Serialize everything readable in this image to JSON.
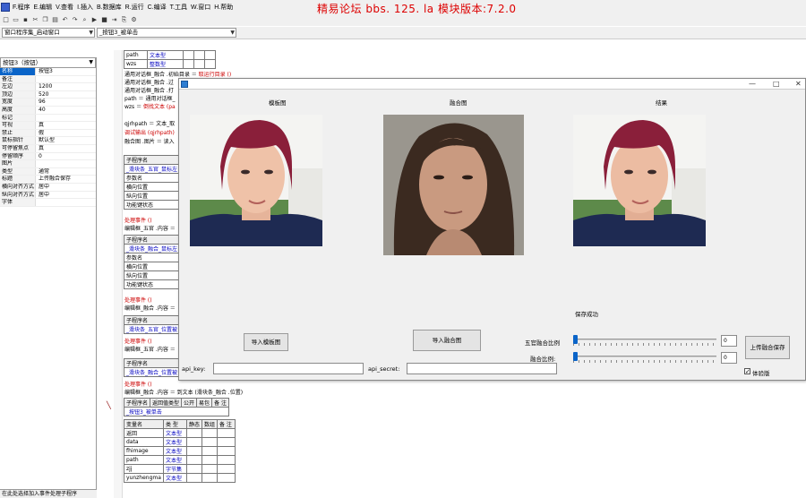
{
  "menu": {
    "items": [
      "F.程序",
      "E.编辑",
      "V.查看",
      "I.插入",
      "B.数据库",
      "R.运行",
      "C.编译",
      "T.工具",
      "W.窗口",
      "H.帮助"
    ],
    "brand": "精易论坛 bbs. 125. la 模块版本:7.2.0"
  },
  "toolbar": {
    "icons": [
      "new-icon",
      "open-icon",
      "save-icon",
      "cut-icon",
      "copy-icon",
      "paste-icon",
      "run-icon",
      "stop-icon"
    ]
  },
  "combos": {
    "window_select": "窗口程序集_启动窗口",
    "event_select": "_按钮3_被单击"
  },
  "left_panel": {
    "object_select": "按钮3（按钮）",
    "props": [
      {
        "name": "名称",
        "value": "按钮3",
        "selected": true
      },
      {
        "name": "备注",
        "value": ""
      },
      {
        "name": "左边",
        "value": "1200"
      },
      {
        "name": "顶边",
        "value": "520"
      },
      {
        "name": "宽度",
        "value": "96"
      },
      {
        "name": "高度",
        "value": "40"
      },
      {
        "name": "标记",
        "value": ""
      },
      {
        "name": "可视",
        "value": "真"
      },
      {
        "name": "禁止",
        "value": "假"
      },
      {
        "name": "鼠标指针",
        "value": "默认型"
      },
      {
        "name": "可停留焦点",
        "value": "真"
      },
      {
        "name": "停留顺序",
        "value": "0"
      },
      {
        "name": "图片",
        "value": ""
      },
      {
        "name": "类型",
        "value": "通常"
      },
      {
        "name": "标题",
        "value": "上传融合保存"
      },
      {
        "name": "横向对齐方式",
        "value": "居中"
      },
      {
        "name": "纵向对齐方式",
        "value": "居中"
      },
      {
        "name": "字体",
        "value": ""
      }
    ],
    "bottom_hint": "在此处选择加入事件处理子程序"
  },
  "code": {
    "top_table": [
      [
        "path",
        "文本型"
      ],
      [
        "wzs",
        "整数型"
      ]
    ],
    "lines": [
      {
        "a": "通用对话框_融合 .初始目录 ＝ ",
        "b": "取运行目录 ()"
      },
      {
        "a": "通用对话框_融合 .过",
        "b": ""
      },
      {
        "a": "通用对话框_融合 .打",
        "b": ""
      },
      {
        "a": "path ＝ 通用对话框_",
        "b": ""
      },
      {
        "a": "wzs ＝ ",
        "b": "倒找文本 (pa"
      },
      {
        "a": "qjrhpath ＝ 文本_取",
        "b": ""
      },
      {
        "a": "调试输出 (qjrhpath)",
        "b": ""
      },
      {
        "a": "融合图 .图片 ＝ 读入",
        "b": ""
      }
    ],
    "sub_header": "子程序名",
    "subs": [
      {
        "name": "_滑块条_五官_鼠标左",
        "params": [
          "参数名",
          "横向位置",
          "纵向位置",
          "功能键状态"
        ],
        "call": "处理事件 ()",
        "edit": "编辑框_五官 .内容 ＝"
      },
      {
        "name": "_滑块条_融合_鼠标左",
        "params": [
          "参数名",
          "横向位置",
          "纵向位置",
          "功能键状态"
        ],
        "call": "处理事件 ()",
        "edit": "编辑框_融合 .内容 ＝"
      },
      {
        "name": "_滑块条_五官_位置被",
        "params": [],
        "call": "处理事件 ()",
        "edit": "编辑框_五官 .内容 ＝"
      },
      {
        "name": "_滑块条_融合_位置被",
        "params": [],
        "call": "处理事件 ()",
        "edit": "编辑框_融合 .内容 ＝ 到文本 (滑块条_融合 .位置)"
      }
    ],
    "bottom_sub": {
      "header": [
        "子程序名",
        "返回值类型",
        "公开",
        "易包",
        "备 注"
      ],
      "name": "_按钮3_被单击",
      "var_header": [
        "变量名",
        "类 型",
        "静态",
        "数组",
        "备 注"
      ],
      "vars": [
        [
          "返回",
          "文本型"
        ],
        [
          "data",
          "文本型"
        ],
        [
          "fhimage",
          "文本型"
        ],
        [
          "path",
          "文本型"
        ],
        [
          "zjj",
          "字节集"
        ],
        [
          "yunzhengma",
          "文本型"
        ]
      ]
    }
  },
  "dialog": {
    "labels": {
      "template": "模板图",
      "fusion": "融合图",
      "result": "结果"
    },
    "status": "保存成功",
    "btn_import_template": "导入模板图",
    "btn_import_fusion": "导入融合图",
    "btn_upload": "上传融合保存",
    "api_key_label": "api_key:",
    "api_secret_label": "api_secret:",
    "api_key_value": "",
    "api_secret_value": "",
    "facial_ratio_label": "五官融合比例",
    "fusion_ratio_label": "融合比例:",
    "facial_ratio_value": "0",
    "fusion_ratio_value": "0",
    "facial_ratio_level": 0,
    "fusion_ratio_level": 0,
    "trial_label": "体验版",
    "trial_checked": true
  }
}
